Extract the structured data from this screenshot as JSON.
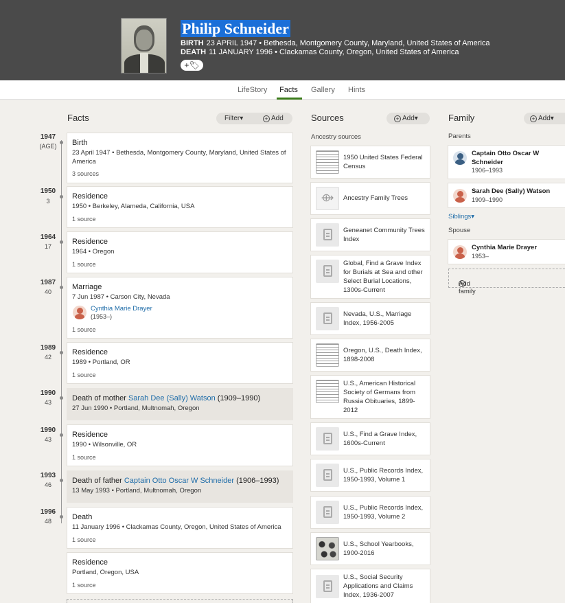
{
  "person": {
    "name": "Philip Schneider",
    "birth_label": "BIRTH",
    "birth_value": "23 APRIL 1947 • Bethesda, Montgomery County, Maryland, United States of America",
    "death_label": "DEATH",
    "death_value": "11 JANUARY 1996 • Clackamas County, Oregon, United States of America",
    "tag_button": "+🏷"
  },
  "tabs": [
    "LifeStory",
    "Facts",
    "Gallery",
    "Hints"
  ],
  "facts_panel": {
    "title": "Facts",
    "filter_label": "Filter",
    "add_label": "Add",
    "items": [
      {
        "year": "1947",
        "age": "(AGE)",
        "title": "Birth",
        "detail": "23 April 1947 • Bethesda, Montgomery County, Maryland, United States of America",
        "sources": "3 sources"
      },
      {
        "year": "1950",
        "age": "3",
        "title": "Residence",
        "detail": "1950 • Berkeley, Alameda, California, USA",
        "sources": "1 source"
      },
      {
        "year": "1964",
        "age": "17",
        "title": "Residence",
        "detail": "1964 • Oregon",
        "sources": "1 source"
      },
      {
        "year": "1987",
        "age": "40",
        "title": "Marriage",
        "detail": "7 Jun 1987 • Carson City, Nevada",
        "spouse_name": "Cynthia Marie Drayer",
        "spouse_dates": "(1953–)",
        "sources": "1 source"
      },
      {
        "year": "1989",
        "age": "42",
        "title": "Residence",
        "detail": "1989 • Portland, OR",
        "sources": "1 source"
      },
      {
        "year": "1990",
        "age": "43",
        "title_prefix": "Death of mother ",
        "title_link": "Sarah Dee (Sally) Watson",
        "title_suffix": " (1909–1990)",
        "detail": "27 Jun 1990 • Portland, Multnomah, Oregon"
      },
      {
        "year": "1990",
        "age": "43",
        "title": "Residence",
        "detail": "1990 • Wilsonville, OR",
        "sources": "1 source"
      },
      {
        "year": "1993",
        "age": "46",
        "title_prefix": "Death of father ",
        "title_link": "Captain Otto Oscar W Schneider",
        "title_suffix": " (1906–1993)",
        "detail": "13 May 1993 • Portland, Multnomah, Oregon"
      },
      {
        "year": "1996",
        "age": "48",
        "title": "Death",
        "detail": "11 January 1996 • Clackamas County, Oregon, United States of America",
        "sources": "1 source"
      },
      {
        "title": "Residence",
        "detail": "Portland, Oregon, USA",
        "sources": "1 source"
      }
    ]
  },
  "sources_panel": {
    "title": "Sources",
    "add_label": "Add",
    "section_label": "Ancestry sources",
    "items": [
      "1950 United States Federal Census",
      "Ancestry Family Trees",
      "Geneanet Community Trees Index",
      "Global, Find a Grave Index for Burials at Sea and other Select Burial Locations, 1300s-Current",
      "Nevada, U.S., Marriage Index, 1956-2005",
      "Oregon, U.S., Death Index, 1898-2008",
      "U.S., American Historical Society of Germans from Russia Obituaries, 1899-2012",
      "U.S., Find a Grave Index, 1600s-Current",
      "U.S., Public Records Index, 1950-1993, Volume 1",
      "U.S., Public Records Index, 1950-1993, Volume 2",
      "U.S., School Yearbooks, 1900-2016",
      "U.S., Social Security Applications and Claims Index, 1936-2007"
    ]
  },
  "family_panel": {
    "title": "Family",
    "add_label": "Add",
    "parents_label": "Parents",
    "parents": [
      {
        "name": "Captain Otto Oscar W Schneider",
        "dates": "1906–1993"
      },
      {
        "name": "Sarah Dee (Sally) Watson",
        "dates": "1909–1990"
      }
    ],
    "siblings_label": "Siblings",
    "spouse_label": "Spouse",
    "spouse": {
      "name": "Cynthia Marie Drayer",
      "dates": "1953–"
    },
    "add_family_label": "Add family"
  }
}
